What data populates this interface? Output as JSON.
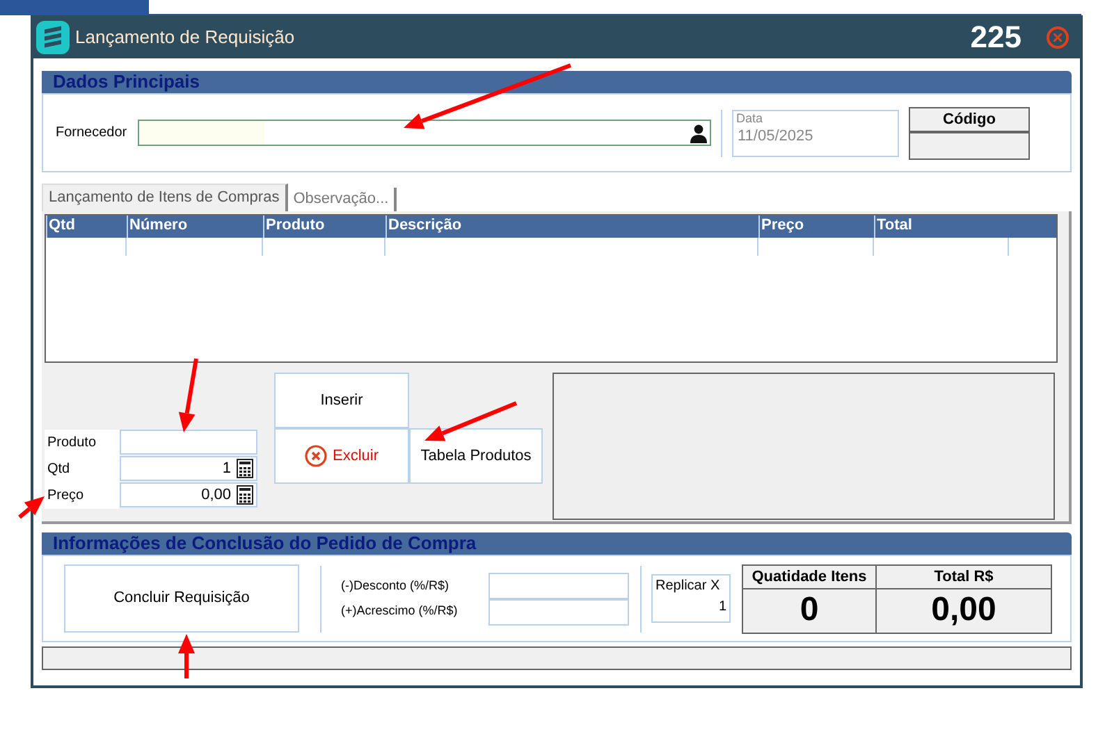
{
  "window": {
    "title": "Lançamento de Requisição",
    "number": "225"
  },
  "main_section": {
    "title": "Dados Principais",
    "supplier_label": "Fornecedor",
    "date_label": "Data",
    "date_value": "11/05/2025",
    "code_label": "Código"
  },
  "tabs": [
    {
      "label": "Lançamento de Itens de Compras",
      "selected": true
    },
    {
      "label": "Observação...",
      "selected": false
    }
  ],
  "table": {
    "columns": [
      "Qtd",
      "Número",
      "Produto",
      "Descrição",
      "Preço",
      "Total"
    ]
  },
  "item_form": {
    "fields": [
      {
        "label": "Produto",
        "calculator": false
      },
      {
        "label": "Qtd",
        "value": "1",
        "calculator": true
      },
      {
        "label": "Preço",
        "value": "0,00",
        "calculator": true
      }
    ],
    "insert_button": "Inserir",
    "delete_button": "Excluir",
    "products_button": "Tabela Produtos"
  },
  "conclusion": {
    "title": "Informações de Conclusão do Pedido de Compra",
    "finish_button": "Concluir Requisição",
    "discount_label": "(-)Desconto  (%/R$)",
    "surcharge_label": "(+)Acrescimo (%/R$)",
    "replicate_label": "Replicar X",
    "replicate_value": "1",
    "count_label": "Quatidade Itens",
    "count_value": "0",
    "total_label": "Total R$",
    "total_value": "0,00"
  }
}
